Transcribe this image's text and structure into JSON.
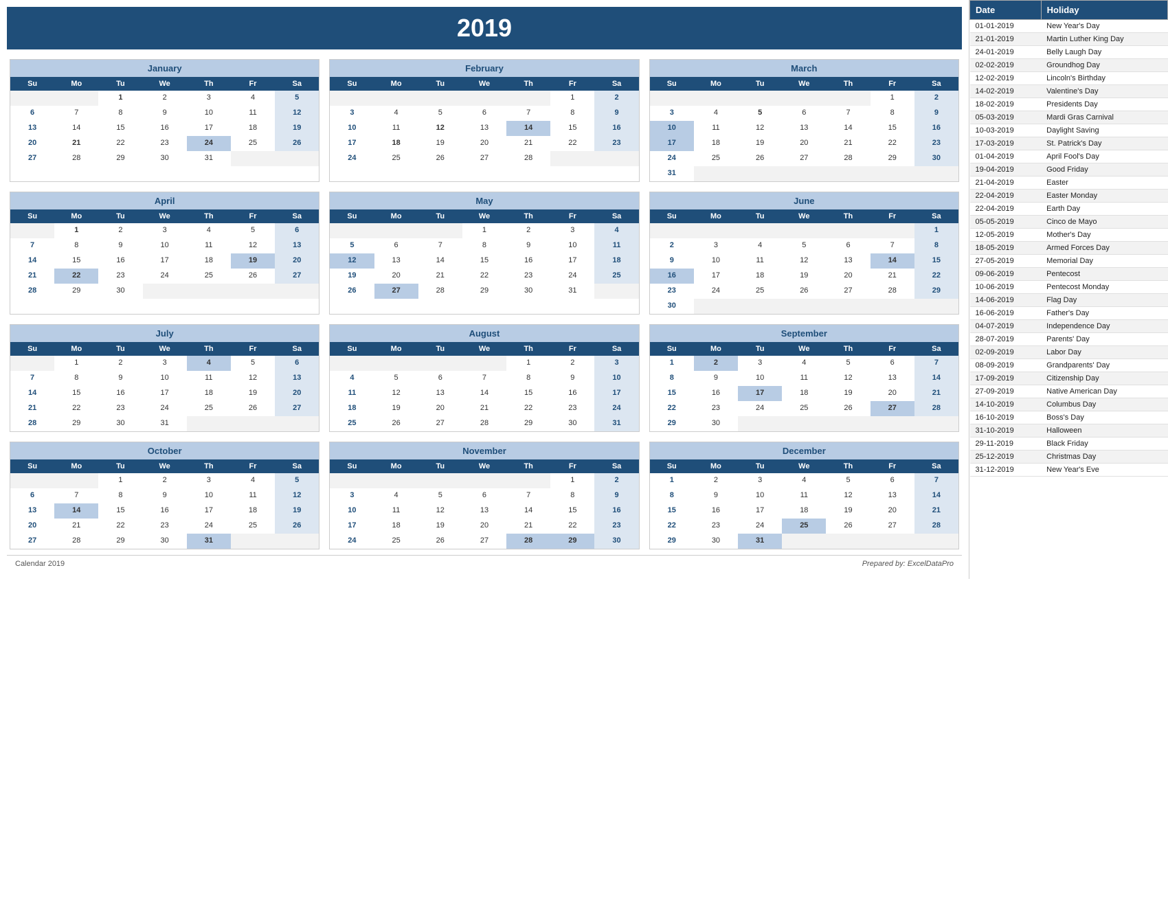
{
  "year": "2019",
  "months": [
    {
      "name": "January",
      "startDay": 2,
      "days": 31,
      "weeks": [
        [
          "",
          "",
          "1",
          "2",
          "3",
          "4",
          "5"
        ],
        [
          "6",
          "7",
          "8",
          "9",
          "10",
          "11",
          "12"
        ],
        [
          "13",
          "14",
          "15",
          "16",
          "17",
          "18",
          "19"
        ],
        [
          "20",
          "21",
          "22",
          "23",
          "24",
          "25",
          "26"
        ],
        [
          "27",
          "28",
          "29",
          "30",
          "31",
          "",
          ""
        ]
      ],
      "bold": [
        "1",
        "5",
        "12",
        "19",
        "21",
        "26",
        "24"
      ],
      "highlighted": [
        "24"
      ],
      "sa_col": 6,
      "su_col": 0
    },
    {
      "name": "February",
      "startDay": 5,
      "days": 28,
      "weeks": [
        [
          "",
          "",
          "",
          "",
          "",
          "1",
          "2"
        ],
        [
          "3",
          "4",
          "5",
          "6",
          "7",
          "8",
          "9"
        ],
        [
          "10",
          "11",
          "12",
          "13",
          "14",
          "15",
          "16"
        ],
        [
          "17",
          "18",
          "19",
          "20",
          "21",
          "22",
          "23"
        ],
        [
          "24",
          "25",
          "26",
          "27",
          "28",
          "",
          ""
        ]
      ],
      "bold": [
        "2",
        "9",
        "16",
        "18",
        "12",
        "14"
      ],
      "highlighted": [
        "14"
      ],
      "sa_col": 6,
      "su_col": 0
    },
    {
      "name": "March",
      "startDay": 5,
      "days": 31,
      "weeks": [
        [
          "",
          "",
          "",
          "",
          "",
          "1",
          "2"
        ],
        [
          "3",
          "4",
          "5",
          "6",
          "7",
          "8",
          "9"
        ],
        [
          "10",
          "11",
          "12",
          "13",
          "14",
          "15",
          "16"
        ],
        [
          "17",
          "18",
          "19",
          "20",
          "21",
          "22",
          "23"
        ],
        [
          "24",
          "25",
          "26",
          "27",
          "28",
          "29",
          "30"
        ],
        [
          "31",
          "",
          "",
          "",
          "",
          "",
          ""
        ]
      ],
      "bold": [
        "2",
        "5",
        "9",
        "10",
        "16",
        "17",
        "23",
        "30"
      ],
      "highlighted": [
        "10",
        "17"
      ],
      "sa_col": 6,
      "su_col": 0
    },
    {
      "name": "April",
      "startDay": 1,
      "days": 30,
      "weeks": [
        [
          "",
          "1",
          "2",
          "3",
          "4",
          "5",
          "6"
        ],
        [
          "7",
          "8",
          "9",
          "10",
          "11",
          "12",
          "13"
        ],
        [
          "14",
          "15",
          "16",
          "17",
          "18",
          "19",
          "20"
        ],
        [
          "21",
          "22",
          "23",
          "24",
          "25",
          "26",
          "27"
        ],
        [
          "28",
          "29",
          "30",
          "",
          "",
          "",
          ""
        ]
      ],
      "bold": [
        "1",
        "6",
        "7",
        "13",
        "14",
        "19",
        "20",
        "21",
        "22",
        "27"
      ],
      "highlighted": [
        "19",
        "22"
      ],
      "sa_col": 6,
      "su_col": 0
    },
    {
      "name": "May",
      "startDay": 3,
      "days": 31,
      "weeks": [
        [
          "",
          "",
          "",
          "1",
          "2",
          "3",
          "4"
        ],
        [
          "5",
          "6",
          "7",
          "8",
          "9",
          "10",
          "11"
        ],
        [
          "12",
          "13",
          "14",
          "15",
          "16",
          "17",
          "18"
        ],
        [
          "19",
          "20",
          "21",
          "22",
          "23",
          "24",
          "25"
        ],
        [
          "26",
          "27",
          "28",
          "29",
          "30",
          "31",
          ""
        ]
      ],
      "bold": [
        "4",
        "5",
        "11",
        "12",
        "18",
        "19",
        "25",
        "26",
        "27"
      ],
      "highlighted": [
        "12",
        "27"
      ],
      "sa_col": 6,
      "su_col": 0
    },
    {
      "name": "June",
      "startDay": 6,
      "days": 30,
      "weeks": [
        [
          "",
          "",
          "",
          "",
          "",
          "",
          "1"
        ],
        [
          "2",
          "3",
          "4",
          "5",
          "6",
          "7",
          "8"
        ],
        [
          "9",
          "10",
          "11",
          "12",
          "13",
          "14",
          "15"
        ],
        [
          "16",
          "17",
          "18",
          "19",
          "20",
          "21",
          "22"
        ],
        [
          "23",
          "24",
          "25",
          "26",
          "27",
          "28",
          "29"
        ],
        [
          "30",
          "",
          "",
          "",
          "",
          "",
          ""
        ]
      ],
      "bold": [
        "1",
        "2",
        "8",
        "9",
        "14",
        "15",
        "16",
        "22",
        "29"
      ],
      "highlighted": [
        "14",
        "16"
      ],
      "sa_col": 6,
      "su_col": 0
    },
    {
      "name": "July",
      "startDay": 1,
      "days": 31,
      "weeks": [
        [
          "",
          "1",
          "2",
          "3",
          "4",
          "5",
          "6"
        ],
        [
          "7",
          "8",
          "9",
          "10",
          "11",
          "12",
          "13"
        ],
        [
          "14",
          "15",
          "16",
          "17",
          "18",
          "19",
          "20"
        ],
        [
          "21",
          "22",
          "23",
          "24",
          "25",
          "26",
          "27"
        ],
        [
          "28",
          "29",
          "30",
          "31",
          "",
          "",
          ""
        ]
      ],
      "bold": [
        "4",
        "6",
        "7",
        "13",
        "14",
        "20",
        "21",
        "27",
        "28"
      ],
      "highlighted": [
        "4"
      ],
      "sa_col": 6,
      "su_col": 0
    },
    {
      "name": "August",
      "startDay": 4,
      "days": 31,
      "weeks": [
        [
          "",
          "",
          "",
          "",
          "1",
          "2",
          "3"
        ],
        [
          "4",
          "5",
          "6",
          "7",
          "8",
          "9",
          "10"
        ],
        [
          "11",
          "12",
          "13",
          "14",
          "15",
          "16",
          "17"
        ],
        [
          "18",
          "19",
          "20",
          "21",
          "22",
          "23",
          "24"
        ],
        [
          "25",
          "26",
          "27",
          "28",
          "29",
          "30",
          "31"
        ]
      ],
      "bold": [
        "3",
        "4",
        "10",
        "11",
        "17",
        "18",
        "24",
        "25",
        "31"
      ],
      "highlighted": [],
      "sa_col": 6,
      "su_col": 0
    },
    {
      "name": "September",
      "startDay": 0,
      "days": 30,
      "weeks": [
        [
          "1",
          "2",
          "3",
          "4",
          "5",
          "6",
          "7"
        ],
        [
          "8",
          "9",
          "10",
          "11",
          "12",
          "13",
          "14"
        ],
        [
          "15",
          "16",
          "17",
          "18",
          "19",
          "20",
          "21"
        ],
        [
          "22",
          "23",
          "24",
          "25",
          "26",
          "27",
          "28"
        ],
        [
          "29",
          "30",
          "",
          "",
          "",
          "",
          ""
        ]
      ],
      "bold": [
        "1",
        "2",
        "7",
        "8",
        "14",
        "15",
        "17",
        "21",
        "22",
        "27",
        "28",
        "29"
      ],
      "highlighted": [
        "2",
        "17",
        "27"
      ],
      "sa_col": 6,
      "su_col": 0
    },
    {
      "name": "October",
      "startDay": 2,
      "days": 31,
      "weeks": [
        [
          "",
          "",
          "1",
          "2",
          "3",
          "4",
          "5"
        ],
        [
          "6",
          "7",
          "8",
          "9",
          "10",
          "11",
          "12"
        ],
        [
          "13",
          "14",
          "15",
          "16",
          "17",
          "18",
          "19"
        ],
        [
          "20",
          "21",
          "22",
          "23",
          "24",
          "25",
          "26"
        ],
        [
          "27",
          "28",
          "29",
          "30",
          "31",
          "",
          ""
        ]
      ],
      "bold": [
        "5",
        "6",
        "12",
        "13",
        "14",
        "19",
        "26",
        "27",
        "31"
      ],
      "highlighted": [
        "14",
        "31"
      ],
      "sa_col": 6,
      "su_col": 0
    },
    {
      "name": "November",
      "startDay": 5,
      "days": 30,
      "weeks": [
        [
          "",
          "",
          "",
          "",
          "",
          "1",
          "2"
        ],
        [
          "3",
          "4",
          "5",
          "6",
          "7",
          "8",
          "9"
        ],
        [
          "10",
          "11",
          "12",
          "13",
          "14",
          "15",
          "16"
        ],
        [
          "17",
          "18",
          "19",
          "20",
          "21",
          "22",
          "23"
        ],
        [
          "24",
          "25",
          "26",
          "27",
          "28",
          "29",
          "30"
        ]
      ],
      "bold": [
        "2",
        "3",
        "9",
        "10",
        "16",
        "17",
        "23",
        "24",
        "28",
        "29"
      ],
      "highlighted": [
        "28",
        "29"
      ],
      "sa_col": 6,
      "su_col": 0
    },
    {
      "name": "December",
      "startDay": 0,
      "days": 31,
      "weeks": [
        [
          "1",
          "2",
          "3",
          "4",
          "5",
          "6",
          "7"
        ],
        [
          "8",
          "9",
          "10",
          "11",
          "12",
          "13",
          "14"
        ],
        [
          "15",
          "16",
          "17",
          "18",
          "19",
          "20",
          "21"
        ],
        [
          "22",
          "23",
          "24",
          "25",
          "26",
          "27",
          "28"
        ],
        [
          "29",
          "30",
          "31",
          "",
          "",
          "",
          ""
        ]
      ],
      "bold": [
        "1",
        "7",
        "8",
        "14",
        "15",
        "21",
        "22",
        "25",
        "28",
        "29",
        "31"
      ],
      "highlighted": [
        "25",
        "31"
      ],
      "sa_col": 6,
      "su_col": 0
    }
  ],
  "dayHeaders": [
    "Su",
    "Mo",
    "Tu",
    "We",
    "Th",
    "Fr",
    "Sa"
  ],
  "holidays": [
    {
      "date": "01-01-2019",
      "name": "New Year's Day"
    },
    {
      "date": "21-01-2019",
      "name": "Martin Luther King Day"
    },
    {
      "date": "24-01-2019",
      "name": "Belly Laugh Day"
    },
    {
      "date": "02-02-2019",
      "name": "Groundhog Day"
    },
    {
      "date": "12-02-2019",
      "name": "Lincoln's Birthday"
    },
    {
      "date": "14-02-2019",
      "name": "Valentine's Day"
    },
    {
      "date": "18-02-2019",
      "name": "Presidents Day"
    },
    {
      "date": "05-03-2019",
      "name": "Mardi Gras Carnival"
    },
    {
      "date": "10-03-2019",
      "name": "Daylight Saving"
    },
    {
      "date": "17-03-2019",
      "name": "St. Patrick's Day"
    },
    {
      "date": "01-04-2019",
      "name": "April Fool's Day"
    },
    {
      "date": "19-04-2019",
      "name": "Good Friday"
    },
    {
      "date": "21-04-2019",
      "name": "Easter"
    },
    {
      "date": "22-04-2019",
      "name": "Easter Monday"
    },
    {
      "date": "22-04-2019",
      "name": "Earth Day"
    },
    {
      "date": "05-05-2019",
      "name": "Cinco de Mayo"
    },
    {
      "date": "12-05-2019",
      "name": "Mother's Day"
    },
    {
      "date": "18-05-2019",
      "name": "Armed Forces Day"
    },
    {
      "date": "27-05-2019",
      "name": "Memorial Day"
    },
    {
      "date": "09-06-2019",
      "name": "Pentecost"
    },
    {
      "date": "10-06-2019",
      "name": "Pentecost Monday"
    },
    {
      "date": "14-06-2019",
      "name": "Flag Day"
    },
    {
      "date": "16-06-2019",
      "name": "Father's Day"
    },
    {
      "date": "04-07-2019",
      "name": "Independence Day"
    },
    {
      "date": "28-07-2019",
      "name": "Parents' Day"
    },
    {
      "date": "02-09-2019",
      "name": "Labor Day"
    },
    {
      "date": "08-09-2019",
      "name": "Grandparents' Day"
    },
    {
      "date": "17-09-2019",
      "name": "Citizenship Day"
    },
    {
      "date": "27-09-2019",
      "name": "Native American Day"
    },
    {
      "date": "14-10-2019",
      "name": "Columbus Day"
    },
    {
      "date": "16-10-2019",
      "name": "Boss's Day"
    },
    {
      "date": "31-10-2019",
      "name": "Halloween"
    },
    {
      "date": "29-11-2019",
      "name": "Black Friday"
    },
    {
      "date": "25-12-2019",
      "name": "Christmas Day"
    },
    {
      "date": "31-12-2019",
      "name": "New Year's Eve"
    }
  ],
  "footer_left": "Calendar 2019",
  "footer_right": "Prepared by: ExcelDataPro",
  "holiday_col1": "Date",
  "holiday_col2": "Holiday"
}
